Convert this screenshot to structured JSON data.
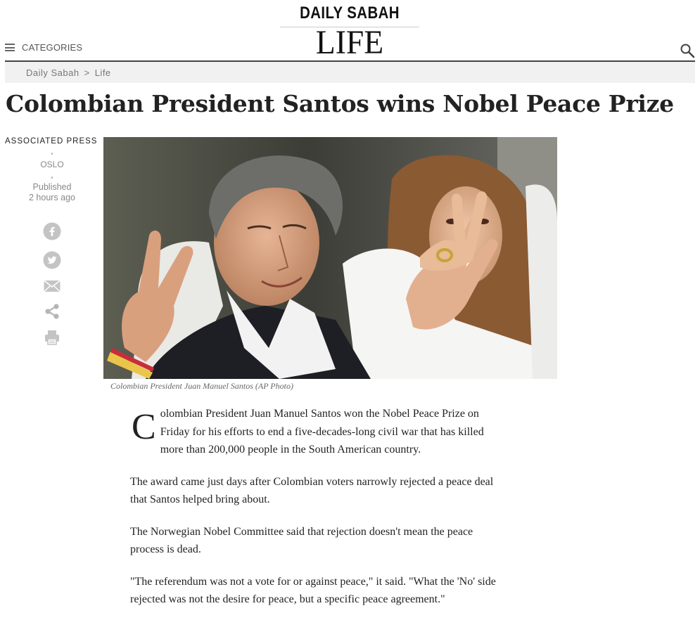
{
  "header": {
    "brand_top": "DAILY SABAH",
    "brand_bottom": "LIFE",
    "categories_label": "CATEGORIES",
    "menu_icon": "hamburger-icon",
    "search_icon": "search-icon"
  },
  "breadcrumb": {
    "items": [
      "Daily Sabah",
      "Life"
    ],
    "separator": ">"
  },
  "article": {
    "title": "Colombian President Santos wins Nobel Peace Prize",
    "author": "ASSOCIATED PRESS",
    "location": "OSLO",
    "published_label": "Published",
    "published_time": "2 hours ago",
    "share_icons": [
      "facebook-icon",
      "twitter-icon",
      "email-icon",
      "share-icon",
      "print-icon"
    ],
    "photo_caption": "Colombian President Juan Manuel Santos (AP Photo)",
    "dropcap": "C",
    "lead": "olombian President Juan Manuel Santos won the Nobel Peace Prize on Friday for his efforts to end a five-decades-long civil war that has killed more than 200,000 people in the South American country.",
    "paragraphs": [
      "The award came just days after Colombian voters narrowly rejected a peace deal that Santos helped bring about.",
      "The Norwegian Nobel Committee said that rejection doesn't mean the peace process is dead.",
      "\"The referendum was not a vote for or against peace,\" it said. \"What the 'No' side rejected was not the desire for peace, but a specific peace agreement.\""
    ]
  },
  "colors": {
    "text": "#222222",
    "muted": "#888888",
    "breadcrumb_bg": "#f1f1f1",
    "icon_gray": "#b5b5b5"
  }
}
